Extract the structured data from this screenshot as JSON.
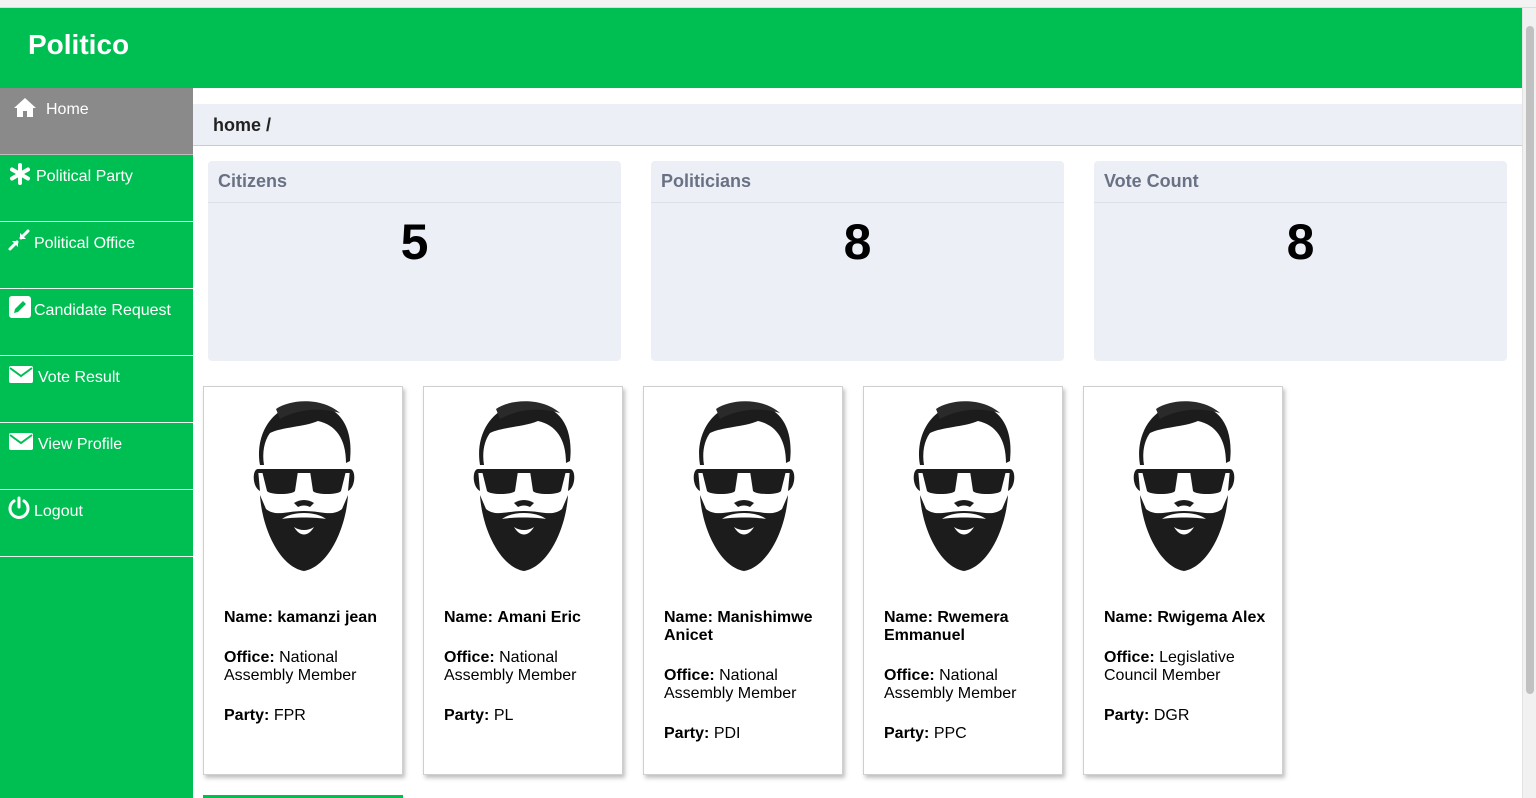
{
  "app": {
    "title": "Politico"
  },
  "sidebar": {
    "items": [
      {
        "label": "Home",
        "icon": "home-icon",
        "active": true
      },
      {
        "label": "Political Party",
        "icon": "asterisk-icon"
      },
      {
        "label": "Political Office",
        "icon": "compress-icon"
      },
      {
        "label": "Candidate Request",
        "icon": "edit-icon"
      },
      {
        "label": "Vote Result",
        "icon": "envelope-icon"
      },
      {
        "label": "View Profile",
        "icon": "envelope-icon"
      },
      {
        "label": "Logout",
        "icon": "power-icon"
      }
    ]
  },
  "breadcrumb": {
    "text": "home /"
  },
  "stats": [
    {
      "title": "Citizens",
      "value": "5"
    },
    {
      "title": "Politicians",
      "value": "8"
    },
    {
      "title": "Vote Count",
      "value": "8"
    }
  ],
  "labels": {
    "name": "Name:",
    "office": "Office:",
    "party": "Party:"
  },
  "candidates": [
    {
      "name": "kamanzi jean",
      "office": "National Assembly Member",
      "party": "FPR"
    },
    {
      "name": "Amani Eric",
      "office": "National Assembly Member",
      "party": "PL"
    },
    {
      "name": "Manishimwe Anicet",
      "office": "National Assembly Member",
      "party": "PDI"
    },
    {
      "name": "Rwemera Emmanuel",
      "office": "National Assembly Member",
      "party": "PPC"
    },
    {
      "name": "Rwigema Alex",
      "office": "Legislative Council Member",
      "party": "DGR"
    }
  ],
  "colors": {
    "brand": "#00bf52",
    "active_nav": "#8a8a8a",
    "panel": "#eceff6"
  }
}
